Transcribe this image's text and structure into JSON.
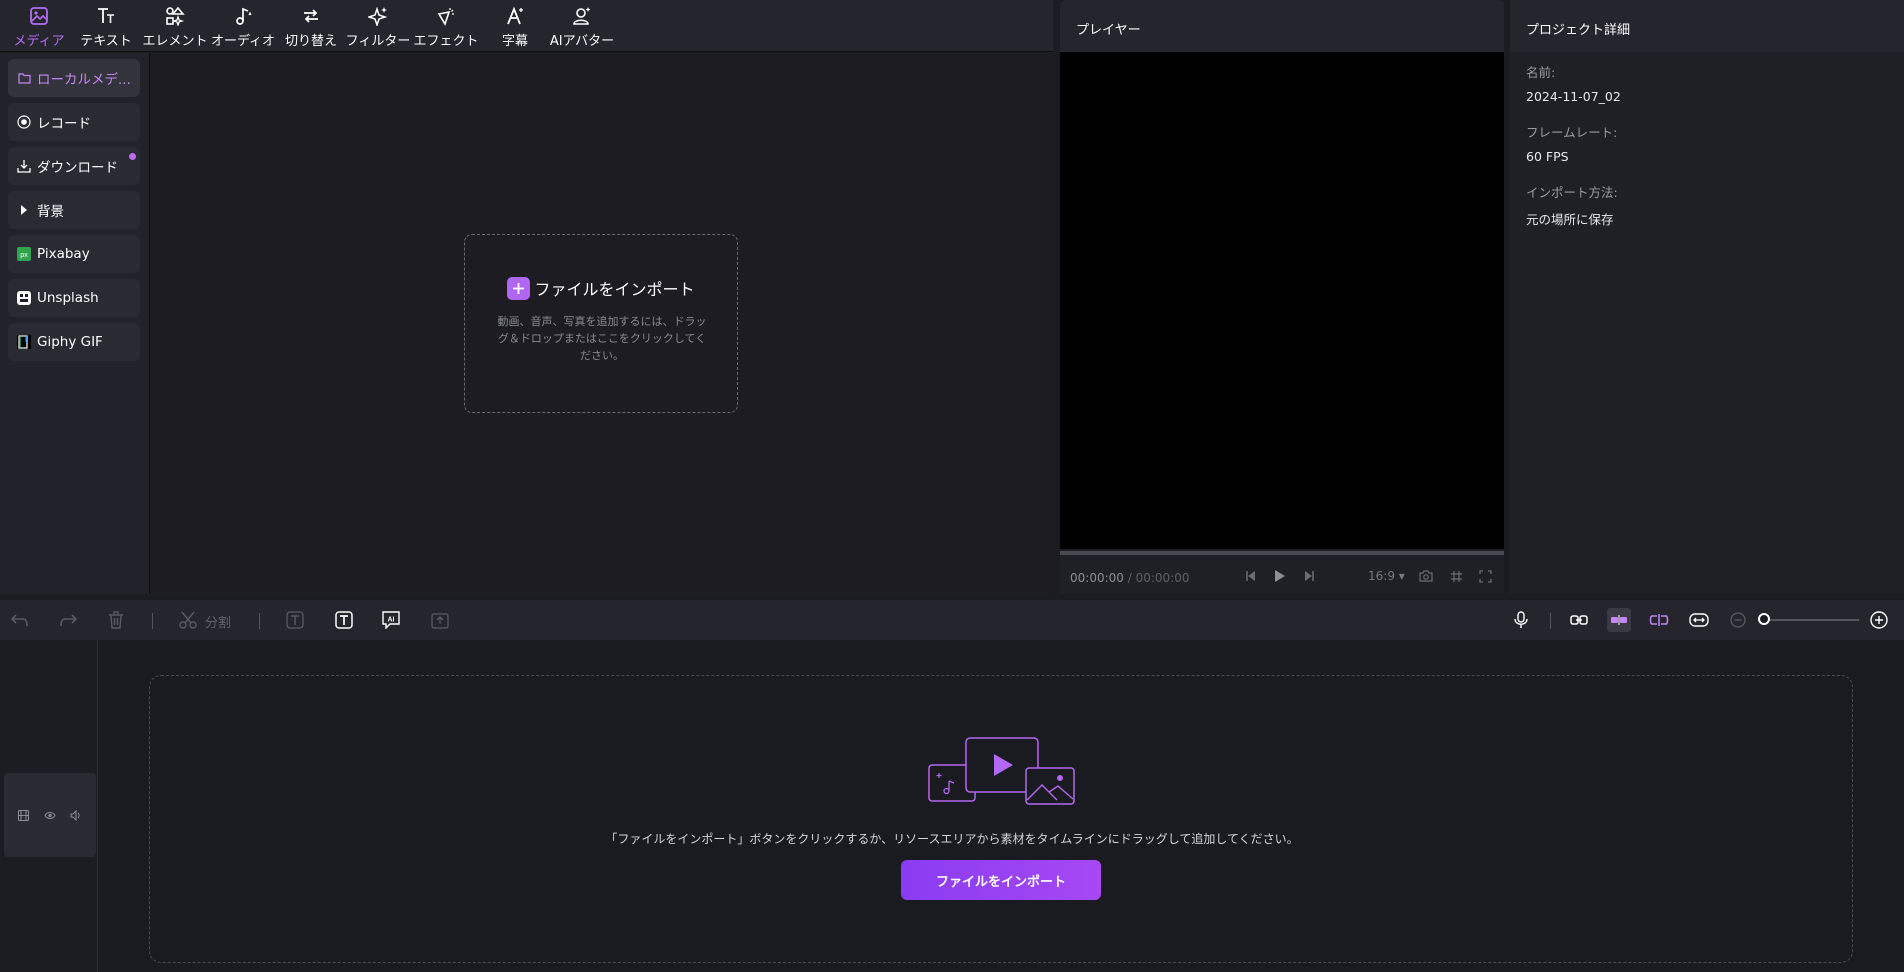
{
  "toolbar": {
    "items": [
      {
        "label": "メディア",
        "icon": "media-icon"
      },
      {
        "label": "テキスト",
        "icon": "text-icon"
      },
      {
        "label": "エレメント",
        "icon": "element-icon"
      },
      {
        "label": "オーディオ",
        "icon": "audio-icon"
      },
      {
        "label": "切り替え",
        "icon": "transition-icon"
      },
      {
        "label": "フィルター",
        "icon": "filter-icon"
      },
      {
        "label": "エフェクト",
        "icon": "effect-icon"
      },
      {
        "label": "字幕",
        "icon": "subtitle-icon"
      },
      {
        "label": "AIアバター",
        "icon": "ai-avatar-icon"
      }
    ],
    "active_color": "#b66cf5"
  },
  "sidebar": {
    "items": [
      {
        "label": "ローカルメデ...",
        "icon": "folder-icon"
      },
      {
        "label": "レコード",
        "icon": "record-icon"
      },
      {
        "label": "ダウンロード",
        "icon": "download-icon"
      },
      {
        "label": "背景",
        "icon": "caret-right-icon"
      },
      {
        "label": "Pixabay",
        "icon": "pixabay-icon"
      },
      {
        "label": "Unsplash",
        "icon": "unsplash-icon"
      },
      {
        "label": "Giphy GIF",
        "icon": "giphy-icon"
      }
    ]
  },
  "import_box": {
    "title": "ファイルをインポート",
    "description": "動画、音声、写真を追加するには、ドラッグ＆ドロップまたはここをクリックしてください。"
  },
  "player": {
    "title": "プレイヤー",
    "current_time": "00:00:00",
    "separator": "/",
    "total_time": "00:00:00",
    "aspect_ratio": "16:9"
  },
  "details": {
    "title": "プロジェクト詳細",
    "name_label": "名前:",
    "name_value": "2024-11-07_02",
    "framerate_label": "フレームレート:",
    "framerate_value": "60 FPS",
    "import_label": "インポート方法:",
    "import_value": "元の場所に保存"
  },
  "timeline_toolbar": {
    "split_label": "分割"
  },
  "timeline": {
    "hint": "「ファイルをインポート」ボタンをクリックするか、リソースエリアから素材をタイムラインにドラッグして追加してください。",
    "import_button": "ファイルをインポート",
    "accent": "#a648f4"
  }
}
